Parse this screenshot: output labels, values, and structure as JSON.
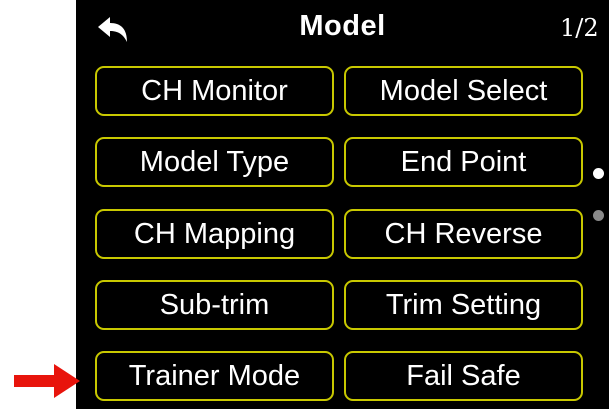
{
  "header": {
    "title": "Model",
    "page_indicator": "1/2",
    "back_icon": "back-arrow-icon"
  },
  "menu": {
    "buttons": [
      {
        "label": "CH Monitor"
      },
      {
        "label": "Model Select"
      },
      {
        "label": "Model Type"
      },
      {
        "label": "End Point"
      },
      {
        "label": "CH Mapping"
      },
      {
        "label": "CH Reverse"
      },
      {
        "label": "Sub-trim"
      },
      {
        "label": "Trim Setting"
      },
      {
        "label": "Trainer Mode"
      },
      {
        "label": "Fail Safe"
      }
    ]
  },
  "pagination": {
    "current_page": 1,
    "total_pages": 2
  },
  "annotation": {
    "pointer_icon": "red-arrow-icon",
    "points_to": "Trainer Mode",
    "color": "#e8140c"
  },
  "colors": {
    "screen_background": "#000000",
    "button_border": "#c8c800",
    "text": "#ffffff",
    "dot_active": "#ffffff",
    "dot_inactive": "#8a8a8a"
  }
}
